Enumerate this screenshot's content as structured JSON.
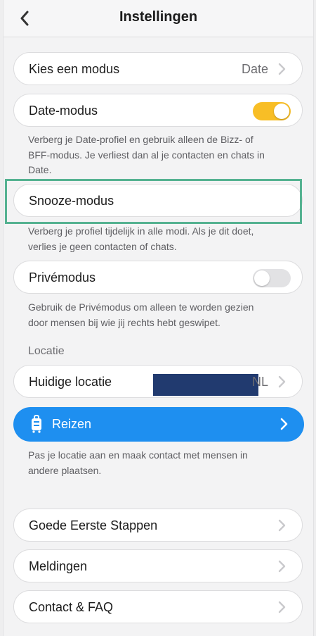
{
  "header": {
    "title": "Instellingen"
  },
  "mode_row": {
    "label": "Kies een modus",
    "value": "Date"
  },
  "date_mode": {
    "label": "Date-modus",
    "enabled": true,
    "desc_lines": [
      "Verberg je Date-profiel en gebruik alleen de Bizz- of",
      "BFF-modus. Je verliest dan al je contacten en chats in",
      "Date."
    ]
  },
  "snooze_mode": {
    "label": "Snooze-modus",
    "desc_lines": [
      "Verberg je profiel tijdelijk in alle modi. Als je dit doet,",
      "verlies je geen contacten of chats."
    ]
  },
  "private_mode": {
    "label": "Privémodus",
    "enabled": false,
    "desc_lines": [
      "Gebruik de Privémodus om alleen te worden gezien",
      "door mensen bij wie jij rechts hebt geswipet."
    ]
  },
  "location": {
    "section_label": "Locatie",
    "current_label": "Huidige locatie",
    "current_value": "NL"
  },
  "travel": {
    "label": "Reizen",
    "desc_lines": [
      "Pas je locatie aan en maak contact met mensen in",
      "andere plaatsen."
    ]
  },
  "links": [
    {
      "label": "Goede Eerste Stappen"
    },
    {
      "label": "Meldingen"
    },
    {
      "label": "Contact & FAQ"
    }
  ],
  "colors": {
    "accent_toggle": "#f8be26",
    "travel_blue": "#1e8ff0",
    "highlight_green": "#55b291"
  }
}
